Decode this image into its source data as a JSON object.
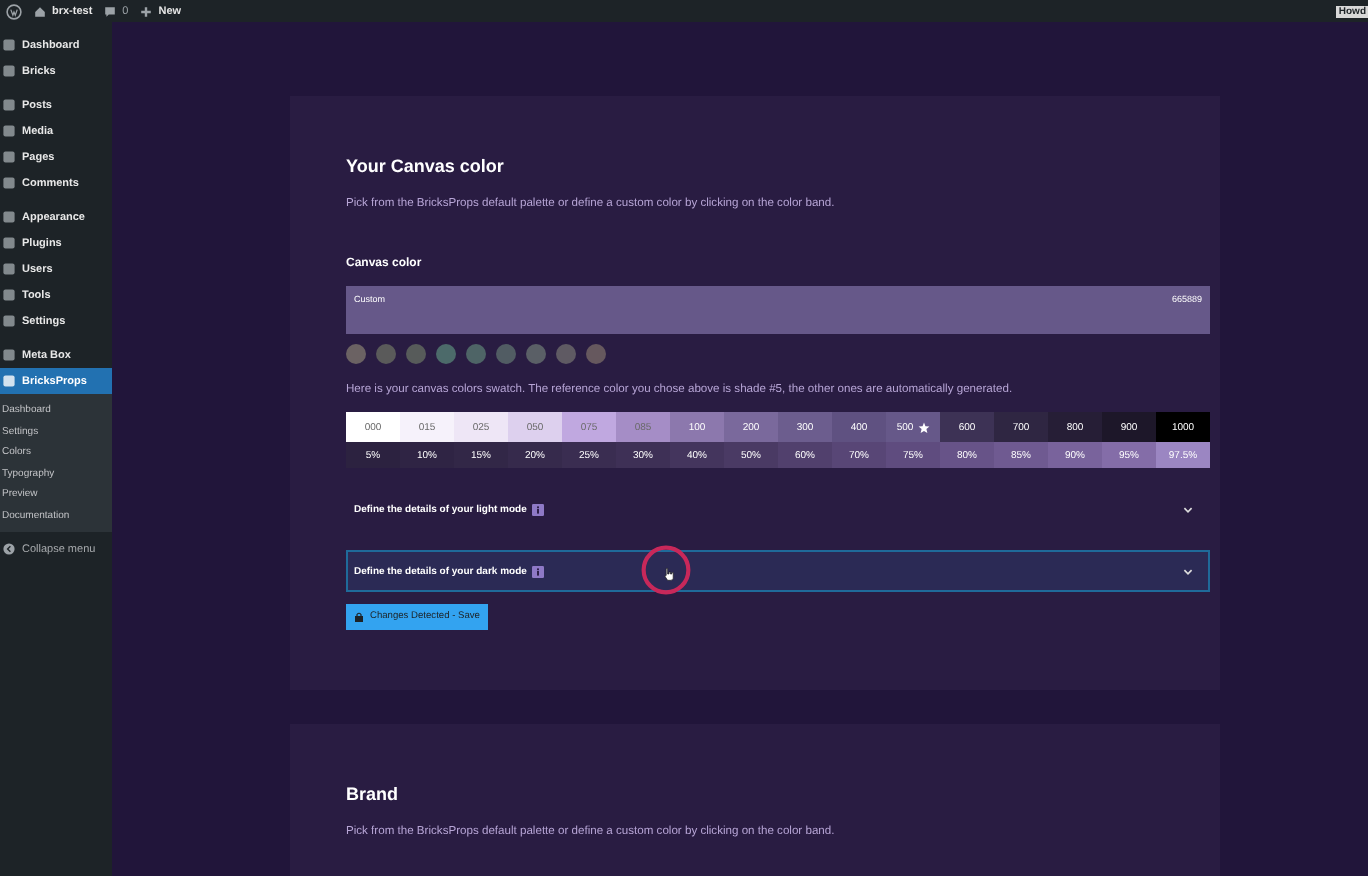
{
  "admin_bar": {
    "site": "brx-test",
    "comments": "0",
    "new": "New",
    "greeting": "Howd"
  },
  "sidebar": {
    "groups": [
      {
        "items": [
          {
            "label": "Dashboard",
            "selected": false
          },
          {
            "label": "Bricks",
            "selected": false
          }
        ]
      },
      {
        "items": [
          {
            "label": "Posts",
            "selected": false
          },
          {
            "label": "Media",
            "selected": false
          },
          {
            "label": "Pages",
            "selected": false
          },
          {
            "label": "Comments",
            "selected": false
          }
        ]
      },
      {
        "items": [
          {
            "label": "Appearance",
            "selected": false
          },
          {
            "label": "Plugins",
            "selected": false
          },
          {
            "label": "Users",
            "selected": false
          },
          {
            "label": "Tools",
            "selected": false
          },
          {
            "label": "Settings",
            "selected": false
          }
        ]
      },
      {
        "items": [
          {
            "label": "Meta Box",
            "selected": false
          },
          {
            "label": "BricksProps",
            "selected": true,
            "children": [
              "Dashboard",
              "Settings",
              "Colors",
              "Typography",
              "Preview",
              "Documentation"
            ]
          }
        ]
      }
    ],
    "collapse": "Collapse menu"
  },
  "sections": [
    {
      "title": "Your Canvas color",
      "description": "Pick from the BricksProps default palette or define a custom color by clicking on the color band.",
      "field_label": "Canvas color",
      "band": {
        "label": "Custom",
        "value": "665889",
        "color": "#665889"
      },
      "palette": [
        {
          "color": "#6b6263"
        },
        {
          "color": "#5a5a5a"
        },
        {
          "color": "#575b5a"
        },
        {
          "color": "#4c6a6a"
        },
        {
          "color": "#4e6466"
        },
        {
          "color": "#515c63"
        },
        {
          "color": "#5a5f66"
        },
        {
          "color": "#5f5a63"
        },
        {
          "color": "#66585e"
        }
      ],
      "swatch_note": "Here is your canvas colors swatch. The reference color you chose above is shade #5, the other ones are automatically generated.",
      "shades": [
        {
          "label": "000",
          "color": "#ffffff",
          "reference": false
        },
        {
          "label": "015",
          "color": "#f6f2fb",
          "reference": false
        },
        {
          "label": "025",
          "color": "#eee6f6",
          "reference": false
        },
        {
          "label": "050",
          "color": "#ddd0ee",
          "reference": false
        },
        {
          "label": "075",
          "color": "#c0a8e0",
          "reference": false
        },
        {
          "label": "085",
          "color": "#a58dc6",
          "reference": false
        },
        {
          "label": "100",
          "color": "#8c78ad",
          "reference": false
        },
        {
          "label": "200",
          "color": "#7a699c",
          "reference": false
        },
        {
          "label": "300",
          "color": "#6c5d8e",
          "reference": false
        },
        {
          "label": "400",
          "color": "#5f5181",
          "reference": false
        },
        {
          "label": "500",
          "color": "#665889",
          "reference": true
        },
        {
          "label": "600",
          "color": "#3d3255",
          "reference": false
        },
        {
          "label": "700",
          "color": "#2f2642",
          "reference": false
        },
        {
          "label": "800",
          "color": "#261e36",
          "reference": false
        },
        {
          "label": "900",
          "color": "#1d1729",
          "reference": false
        },
        {
          "label": "1000",
          "color": "#000000",
          "reference": false
        }
      ],
      "percentages": [
        {
          "label": "5%",
          "color": "#2c2240"
        },
        {
          "label": "10%",
          "color": "#2f2444"
        },
        {
          "label": "15%",
          "color": "#322747"
        },
        {
          "label": "20%",
          "color": "#362a4c"
        },
        {
          "label": "25%",
          "color": "#3a2d51"
        },
        {
          "label": "30%",
          "color": "#3e3056"
        },
        {
          "label": "40%",
          "color": "#44355d"
        },
        {
          "label": "50%",
          "color": "#4a3a64"
        },
        {
          "label": "60%",
          "color": "#51406d"
        },
        {
          "label": "70%",
          "color": "#584676"
        },
        {
          "label": "75%",
          "color": "#5f4c7f"
        },
        {
          "label": "80%",
          "color": "#675388"
        },
        {
          "label": "85%",
          "color": "#6f5a91"
        },
        {
          "label": "90%",
          "color": "#79639c"
        },
        {
          "label": "95%",
          "color": "#846da8"
        },
        {
          "label": "97.5%",
          "color": "#9b86c2"
        }
      ],
      "accordions": [
        {
          "title": "Define the details of your light mode",
          "highlighted": false
        },
        {
          "title": "Define the details of your dark mode",
          "highlighted": true
        }
      ],
      "save_button": "Changes Detected - Save"
    },
    {
      "title": "Brand",
      "description": "Pick from the BricksProps default palette or define a custom color by clicking on the color band."
    }
  ]
}
